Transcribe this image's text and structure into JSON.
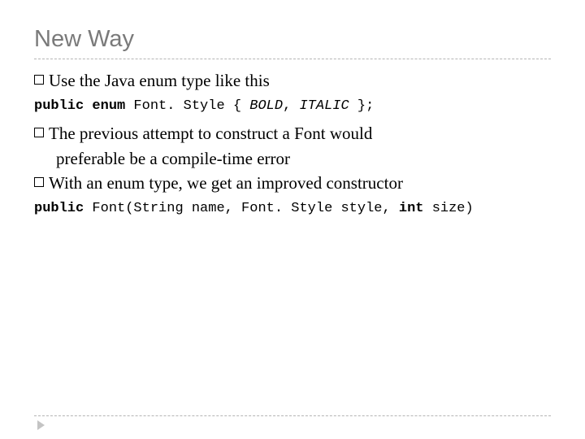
{
  "title": "New Way",
  "bullets": {
    "b1": "Use the Java enum type like this",
    "b2": "The previous attempt to construct a Font would",
    "b2_cont": "preferable be a compile-time error",
    "b3": "With an enum type, we get an improved constructor"
  },
  "code": {
    "kw_public": "public ",
    "kw_enum": "enum",
    "line1_pre": " Font. Style { ",
    "item_bold": "BOLD",
    "comma_sep": ", ",
    "item_italic": "ITALIC",
    "line1_post": " };",
    "line2_mid1": " Font(String name, Font. Style style, ",
    "kw_int": "int",
    "line2_mid2": " size)"
  }
}
